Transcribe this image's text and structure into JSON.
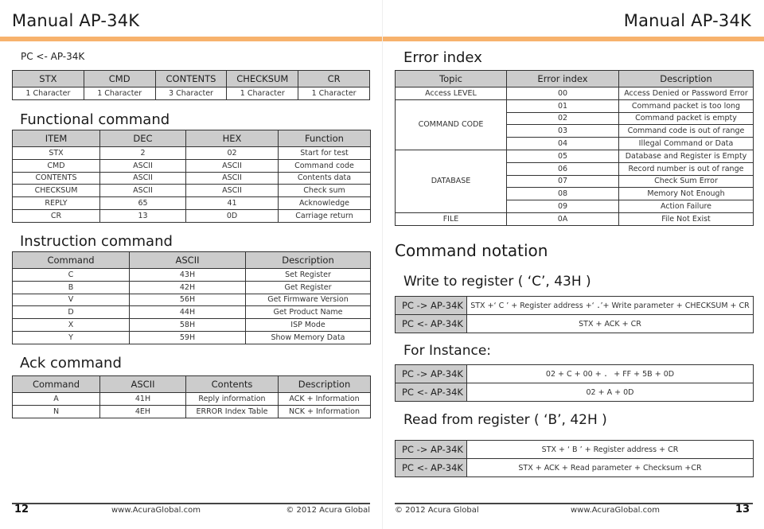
{
  "header": {
    "left_title": "Manual AP-34K",
    "right_title": "Manual AP-34K",
    "accent_color": "#f7b26d"
  },
  "left_page": {
    "frame_label": "PC <- AP-34K",
    "frame_table": {
      "headers": [
        "STX",
        "CMD",
        "CONTENTS",
        "CHECKSUM",
        "CR"
      ],
      "row": [
        "1 Character",
        "1 Character",
        "3 Character",
        "1 Character",
        "1 Character"
      ]
    },
    "functional": {
      "title": "Functional command",
      "headers": [
        "ITEM",
        "DEC",
        "HEX",
        "Function"
      ],
      "rows": [
        [
          "STX",
          "2",
          "02",
          "Start for test"
        ],
        [
          "CMD",
          "ASCII",
          "ASCII",
          "Command code"
        ],
        [
          "CONTENTS",
          "ASCII",
          "ASCII",
          "Contents data"
        ],
        [
          "CHECKSUM",
          "ASCII",
          "ASCII",
          "Check sum"
        ],
        [
          "REPLY",
          "65",
          "41",
          "Acknowledge"
        ],
        [
          "CR",
          "13",
          "0D",
          "Carriage return"
        ]
      ]
    },
    "instruction": {
      "title": "Instruction command",
      "headers": [
        "Command",
        "ASCII",
        "Description"
      ],
      "rows": [
        [
          "C",
          "43H",
          "Set Register"
        ],
        [
          "B",
          "42H",
          "Get Register"
        ],
        [
          "V",
          "56H",
          "Get Firmware Version"
        ],
        [
          "D",
          "44H",
          "Get Product Name"
        ],
        [
          "X",
          "58H",
          "ISP Mode"
        ],
        [
          "Y",
          "59H",
          "Show Memory Data"
        ]
      ]
    },
    "ack": {
      "title": "Ack command",
      "headers": [
        "Command",
        "ASCII",
        "Contents",
        "Description"
      ],
      "rows": [
        [
          "A",
          "41H",
          "Reply information",
          "ACK + Information"
        ],
        [
          "N",
          "4EH",
          "ERROR Index Table",
          "NCK + Information"
        ]
      ]
    },
    "footer": {
      "page_number": "12",
      "website": "www.AcuraGlobal.com",
      "copyright": "© 2012 Acura Global"
    }
  },
  "right_page": {
    "error_index": {
      "title": "Error index",
      "headers": [
        "Topic",
        "Error index",
        "Description"
      ],
      "groups": [
        {
          "topic": "Access LEVEL",
          "rows": [
            [
              "00",
              "Access Denied or Password Error"
            ]
          ]
        },
        {
          "topic": "COMMAND CODE",
          "rows": [
            [
              "01",
              "Command packet is too long"
            ],
            [
              "02",
              "Command packet is empty"
            ],
            [
              "03",
              "Command code is out of range"
            ],
            [
              "04",
              "Illegal Command or Data"
            ]
          ]
        },
        {
          "topic": "DATABASE",
          "rows": [
            [
              "05",
              "Database and Register is Empty"
            ],
            [
              "06",
              "Record number is out of range"
            ],
            [
              "07",
              "Check Sum Error"
            ],
            [
              "08",
              "Memory Not Enough"
            ],
            [
              "09",
              "Action Failure"
            ]
          ]
        },
        {
          "topic": "FILE",
          "rows": [
            [
              "0A",
              "File Not Exist"
            ]
          ]
        }
      ]
    },
    "notation": {
      "title": "Command notation",
      "write": {
        "title": "Write to register ( ‘C’, 43H )",
        "rows": [
          {
            "label": "PC -> AP-34K",
            "value": "STX +‘ C ’ + Register address +‘ ．’+ Write parameter + CHECKSUM + CR"
          },
          {
            "label": "PC <- AP-34K",
            "value": "STX + ACK + CR"
          }
        ]
      },
      "instance": {
        "title": "For Instance:",
        "rows": [
          {
            "label": "PC -> AP-34K",
            "value": "02 + C + 00 + ． + FF + 5B + 0D"
          },
          {
            "label": "PC <- AP-34K",
            "value": "02 + A + 0D"
          }
        ]
      },
      "read": {
        "title": "Read from register ( ‘B’, 42H )",
        "rows": [
          {
            "label": "PC -> AP-34K",
            "value": "STX + ‘ B ’ + Register address + CR"
          },
          {
            "label": "PC <- AP-34K",
            "value": "STX + ACK + Read parameter + Checksum +CR"
          }
        ]
      }
    },
    "footer": {
      "copyright": "© 2012 Acura Global",
      "website": "www.AcuraGlobal.com",
      "page_number": "13"
    }
  }
}
